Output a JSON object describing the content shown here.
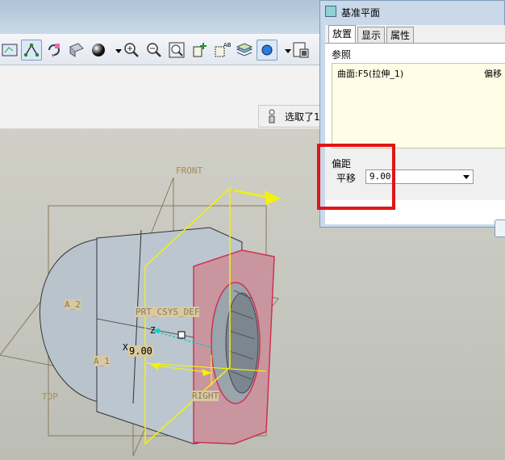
{
  "status": {
    "message": "选取了1"
  },
  "dialog": {
    "title": "基准平面",
    "tabs": [
      "放置",
      "显示",
      "属性"
    ],
    "references": {
      "heading": "参照",
      "item": "曲面:F5(拉伸_1)",
      "constraint": "偏移"
    },
    "offset": {
      "heading": "偏距",
      "translation_label": "平移",
      "value": "9.00"
    }
  },
  "viewport": {
    "labels": {
      "front": "FRONT",
      "a2": "A_2",
      "a1": "A_1",
      "csys": "PRT_CSYS_DEF",
      "z": "Z",
      "x": "X",
      "top": "TOP",
      "right": "RIGHT"
    },
    "dimension_value": "9.00"
  },
  "colors": {
    "highlight": "#e11515",
    "plane_preview": "#f2f20a",
    "part": "#b9c3cc"
  }
}
